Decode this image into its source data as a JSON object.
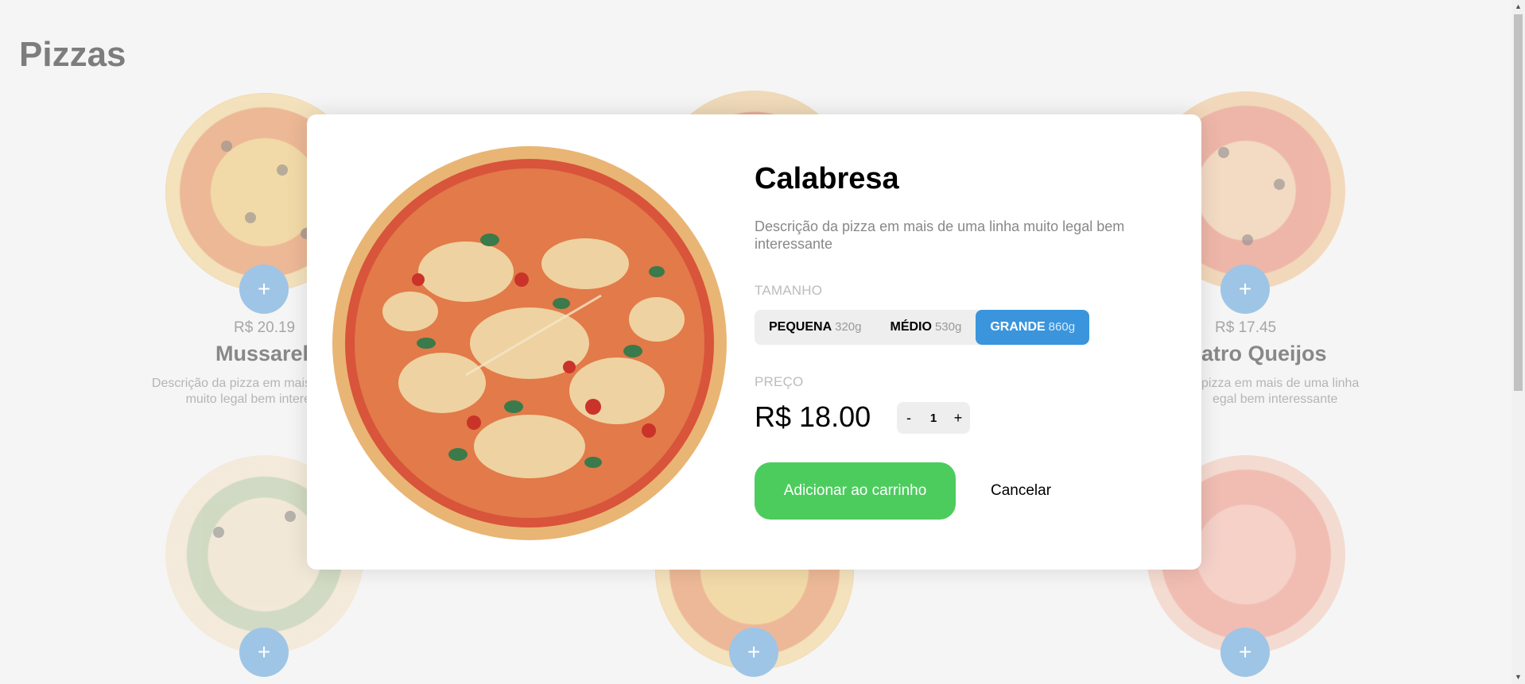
{
  "page": {
    "title": "Pizzas"
  },
  "pizzas": [
    {
      "price": "R$ 20.19",
      "name": "Mussarela",
      "desc": "Descrição da pizza em mais",
      "desc2": "muito legal bem intere"
    },
    {
      "price": "R$ 17.45",
      "name": "atro Queijos",
      "desc": "pizza em mais de uma linha",
      "desc2": "egal bem interessante"
    }
  ],
  "add_glyph": "+",
  "modal": {
    "title": "Calabresa",
    "description": "Descrição da pizza em mais de uma linha muito legal bem interessante",
    "size_label": "TAMANHO",
    "sizes": [
      {
        "label": "PEQUENA",
        "weight": "320g"
      },
      {
        "label": "MÉDIO",
        "weight": "530g"
      },
      {
        "label": "GRANDE",
        "weight": "860g"
      }
    ],
    "selected_size": "GRANDE",
    "price_label": "PREÇO",
    "price": "R$ 18.00",
    "quantity": {
      "minus": "-",
      "value": "1",
      "plus": "+"
    },
    "add_button": "Adicionar ao carrinho",
    "cancel_button": "Cancelar"
  },
  "colors": {
    "accent_blue": "#3a95dc",
    "add_green": "#4ccc5d",
    "plus_circle": "#9ec5e6"
  },
  "icons": {
    "pizza_image": "pizza-image-icon",
    "plus": "plus-icon"
  }
}
